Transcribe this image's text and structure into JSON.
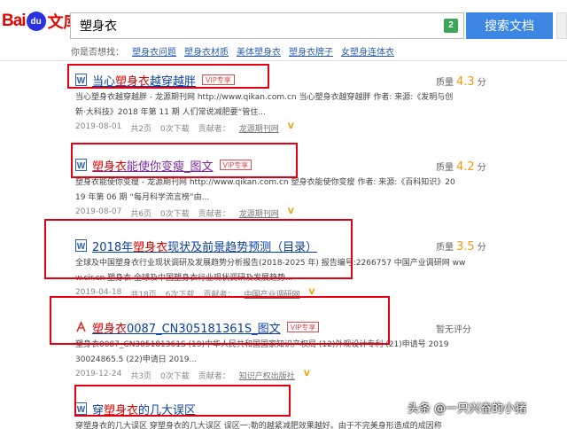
{
  "header": {
    "logo_left": "Bai",
    "logo_paw": "du",
    "logo_right": "文库",
    "search_value": "塑身衣",
    "search_badge": "2",
    "search_button": "搜索文档"
  },
  "suggestions": {
    "label": "你是否想找：",
    "items": [
      "塑身衣问题",
      "塑身衣材质",
      "美体塑身衣",
      "塑身衣牌子",
      "女塑身连体衣"
    ]
  },
  "results": [
    {
      "title_pre": "当心",
      "title_hl": "塑身衣",
      "title_post": "越穿越胖",
      "vip": "VIP专享",
      "snippet1": "当心塑身衣越穿越胖 - 龙源期刊网 http://www.qikan.com.cn 当心塑身衣越穿越胖 作者: 来源:《发明与创",
      "snippet2": "新·大科技》2018 年第 11 期 人们常说减肥要“管住...",
      "date": "2019-08-01",
      "pages": "共2页",
      "downloads": "0次下载",
      "contributor_label": "贡献者：",
      "contributor": "龙源期刊网",
      "score_label": "质量",
      "score": "4.3",
      "score_unit": "分"
    },
    {
      "title_pre": "",
      "title_hl": "塑身衣",
      "title_post": "能使你变瘦_图文",
      "vip": "VIP专享",
      "snippet1": "塑身衣能使你变瘦 - 龙源期刊网 http://www.qikan.com.cn 塑身衣能使你变瘦 作者: 来源:《百科知识》20",
      "snippet2": "19 年第 06 期 “每月科学流言榜”由...",
      "date": "2019-08-07",
      "pages": "共6页",
      "downloads": "0次下载",
      "contributor_label": "贡献者：",
      "contributor": "龙源期刊网",
      "score_label": "质量",
      "score": "4.2",
      "score_unit": "分"
    },
    {
      "title_pre": "2018年",
      "title_hl": "塑身衣",
      "title_post": "现状及前景趋势预测（目录）",
      "vip": "",
      "snippet1": "全球及中国塑身衣行业现状调研及发展趋势分析报告(2018-2025 年) 报告编号:2266757 中国产业调研网 ww",
      "snippet2": "w.cir.cn 塑身衣 全球及中国塑身衣行业现状调研及发展趋势...",
      "date": "2019-04-18",
      "pages": "共18页",
      "downloads": "6次下载",
      "contributor_label": "贡献者：",
      "contributor": "中国产业调研网",
      "score_label": "质量",
      "score": "3.5",
      "score_unit": "分"
    },
    {
      "title_pre": "",
      "title_hl": "塑身衣",
      "title_post": "0087_CN305181361S_图文",
      "vip": "VIP专享",
      "snippet1": "塑身衣0087_CN305181361S (19)中华人民共和国国家知识产权局 (12)外观设计专利 (21)申请号 2019",
      "snippet2": "30024865.5 (22)申请日 2019...",
      "date": "2019-12-24",
      "pages": "共3页",
      "downloads": "0次下载",
      "contributor_label": "贡献者：",
      "contributor": "知识产权出版社",
      "score_label": "暂无评分",
      "score": "",
      "score_unit": ""
    },
    {
      "title_pre": "穿",
      "title_hl": "塑身衣",
      "title_post": "的几大误区",
      "vip": "",
      "snippet1": "穿塑身衣的几大误区 穿塑身衣的几大误区 误区一:勒的越紧减肥效果越好。由于不完美身形造成的成因称",
      "snippet2": "",
      "date": "",
      "pages": "",
      "downloads": "",
      "contributor_label": "",
      "contributor": "",
      "score_label": "",
      "score": "",
      "score_unit": ""
    }
  ],
  "watermark": "头条 @一只兴奋的小猪",
  "colors": {
    "link": "#0a3fa6",
    "highlight": "#dd0000",
    "search_button": "#3c87e4",
    "annotation": "#e60012"
  }
}
